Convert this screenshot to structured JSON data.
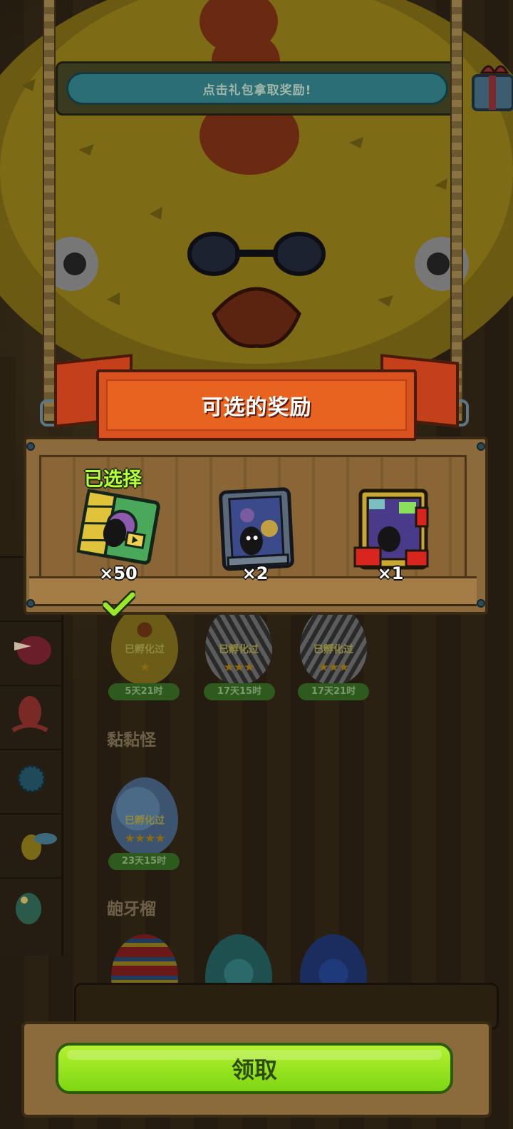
{
  "banner": {
    "prompt": "点击礼包拿取奖励!"
  },
  "panel": {
    "title": "可选的奖励",
    "selected_label": "已选择",
    "rewards": [
      {
        "name": "green-card-pack-icon",
        "qty": "×50",
        "selected": true
      },
      {
        "name": "blue-card-pack-icon",
        "qty": "×2",
        "selected": false
      },
      {
        "name": "gold-card-pack-icon",
        "qty": "×1",
        "selected": false
      }
    ]
  },
  "egg_list": {
    "row1": [
      {
        "status": "已孵化过",
        "stars": "★",
        "timer": "5天21时"
      },
      {
        "status": "已孵化过",
        "stars": "★★★",
        "timer": "17天15时"
      },
      {
        "status": "已孵化过",
        "stars": "★★★",
        "timer": "17天21时"
      }
    ],
    "section2_title": "黏黏怪",
    "row2": [
      {
        "status": "已孵化过",
        "stars": "★★★★",
        "timer": "23天15时"
      }
    ],
    "section3_title": "龅牙榴"
  },
  "footer": {
    "claim_label": "领取"
  },
  "colors": {
    "claim_button": "#8fe01a",
    "selected_text": "#b6ff37",
    "ribbon": "#d9511f"
  }
}
